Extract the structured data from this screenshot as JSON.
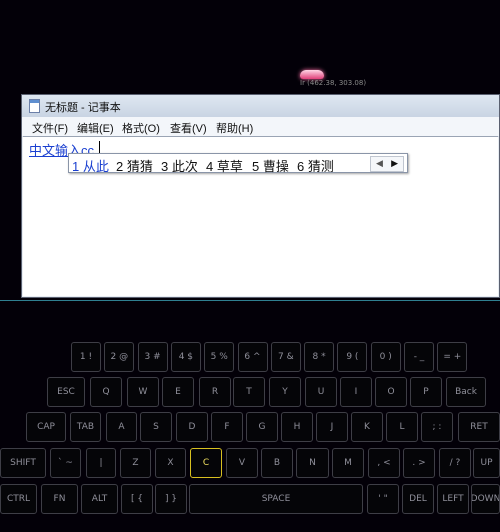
{
  "cursor": {
    "coords": "Ir (462.38, 303.08)"
  },
  "window": {
    "title": "无标题 - 记事本",
    "menu": [
      "文件(F)",
      "编辑(E)",
      "格式(O)",
      "查看(V)",
      "帮助(H)"
    ],
    "text": "中文输入cc"
  },
  "ime": {
    "candidates": [
      "1 从此",
      "2 猜猜",
      "3 此次",
      "4 草草",
      "5 曹操",
      "6 猜测"
    ],
    "prev": "◀",
    "next": "▶"
  },
  "keyboard": {
    "active_key": "C",
    "rows": [
      [
        "1 !",
        "2 @",
        "3 #",
        "4 $",
        "5 %",
        "6 ^",
        "7 &",
        "8 *",
        "9 (",
        "0 )",
        "- _",
        "= +"
      ],
      [
        "ESC",
        "Q",
        "W",
        "E",
        "R",
        "T",
        "Y",
        "U",
        "I",
        "O",
        "P",
        "Back"
      ],
      [
        "CAP",
        "TAB",
        "A",
        "S",
        "D",
        "F",
        "G",
        "H",
        "J",
        "K",
        "L",
        "; :",
        "RET"
      ],
      [
        "SHIFT",
        "` ~",
        "|",
        "Z",
        "X",
        "C",
        "V",
        "B",
        "N",
        "M",
        ", <",
        ". >",
        "/ ?",
        "UP"
      ],
      [
        "CTRL",
        "FN",
        "ALT",
        "[ {",
        "] }",
        "SPACE",
        "' \"",
        "DEL",
        "LEFT",
        "DOWN"
      ]
    ]
  }
}
